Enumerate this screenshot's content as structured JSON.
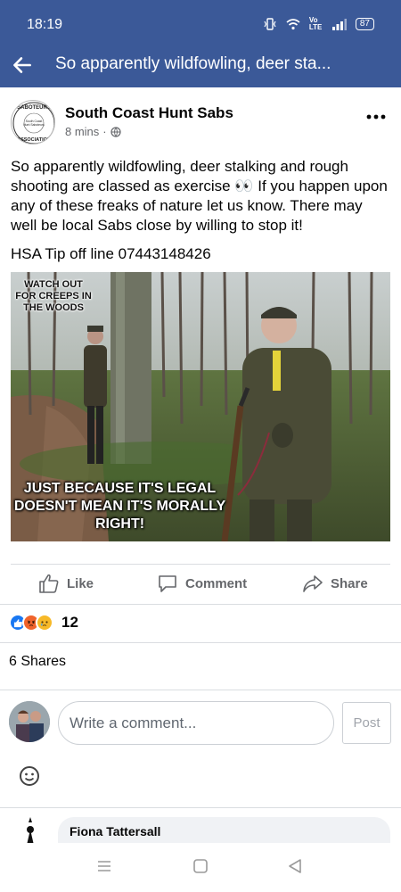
{
  "status": {
    "time": "18:19",
    "battery": "87",
    "network": "Vo LTE"
  },
  "appbar": {
    "title": "So apparently wildfowling, deer sta..."
  },
  "post": {
    "page_name": "South Coast Hunt Sabs",
    "time_ago": "8 mins",
    "meta_separator": "·",
    "logo_text_top": "HUNT SABOTEURS",
    "logo_text_mid": "South Coast Hunt Saboteurs",
    "logo_text_bottom": "ASSOCIATION",
    "body": "So apparently wildfowling, deer stalking and rough shooting are classed as exercise 👀 If you happen upon any of these freaks of nature let us know. There may well be local Sabs close by willing to stop it!",
    "tip_line": "HSA Tip off line 07443148426",
    "image": {
      "top_caption": "WATCH OUT FOR CREEPS IN THE WOODS",
      "bottom_caption": "JUST BECAUSE IT'S LEGAL DOESN'T MEAN IT'S MORALLY RIGHT!"
    }
  },
  "actions": {
    "like": "Like",
    "comment": "Comment",
    "share": "Share"
  },
  "reactions": {
    "count": "12",
    "types": [
      "like-icon",
      "angry-icon",
      "sad-icon"
    ]
  },
  "shares_text": "6 Shares",
  "comment_box": {
    "placeholder": "Write a comment...",
    "post_label": "Post"
  },
  "comments": [
    {
      "author": "Fiona Tattersall"
    }
  ],
  "colors": {
    "header": "#3b5998",
    "like_blue": "#1877f2",
    "angry": "#f0632b",
    "sad": "#f7b928",
    "muted": "#65676b"
  }
}
